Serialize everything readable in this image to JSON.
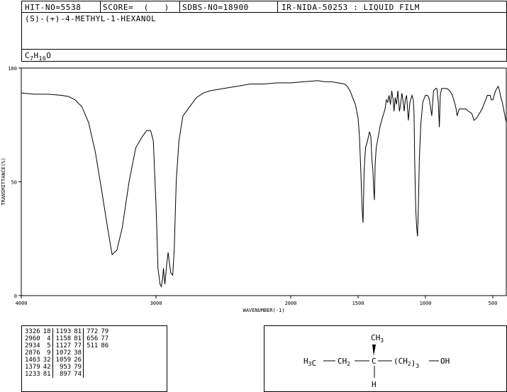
{
  "header": {
    "hit_no": "HIT-NO=5538",
    "score": "SCORE=  (   )",
    "sdbs_no": "SDBS-NO=18900",
    "ir_code": "IR-NIDA-50253 : LIQUID FILM"
  },
  "compound": {
    "name": "(S)-(+)-4-METHYL-1-HEXANOL",
    "formula_parts": [
      "C",
      "7",
      "H",
      "16",
      "O"
    ]
  },
  "structure": {
    "ch3_top": "CH3",
    "chain_left": "H3C",
    "ch2": "CH2",
    "center_c": "C",
    "group": "(CH2)3",
    "oh": "OH",
    "h_bottom": "H"
  },
  "peak_table": {
    "columns": [
      [
        [
          "3326",
          "18"
        ],
        [
          "2960",
          "4"
        ],
        [
          "2934",
          "5"
        ],
        [
          "2876",
          "9"
        ],
        [
          "1463",
          "32"
        ],
        [
          "1379",
          "42"
        ],
        [
          "1233",
          "81"
        ]
      ],
      [
        [
          "1193",
          "81"
        ],
        [
          "1158",
          "81"
        ],
        [
          "1127",
          "77"
        ],
        [
          "1072",
          "38"
        ],
        [
          "1059",
          "26"
        ],
        [
          "953",
          "79"
        ],
        [
          "897",
          "74"
        ]
      ],
      [
        [
          "772",
          "79"
        ],
        [
          "656",
          "77"
        ],
        [
          "511",
          "86"
        ]
      ]
    ]
  },
  "chart_data": {
    "type": "line",
    "title": "",
    "xlabel": "WAVENUMBER(-1)",
    "ylabel": "TRANSMITTANCE(%)",
    "xlim": [
      4000,
      400
    ],
    "ylim": [
      0,
      100
    ],
    "xticks": [
      4000,
      3000,
      2000,
      1500,
      1000,
      500
    ],
    "xtick_labels": [
      "4000",
      "3000",
      "2000",
      "1500",
      "1000",
      "500"
    ],
    "yticks": [
      0,
      50,
      100
    ],
    "ytick_labels": [
      "0",
      "50",
      "100"
    ],
    "grid": false,
    "series": [
      {
        "name": "",
        "x": [
          4000,
          3900,
          3800,
          3700,
          3650,
          3600,
          3550,
          3500,
          3450,
          3400,
          3360,
          3326,
          3290,
          3250,
          3200,
          3150,
          3100,
          3070,
          3040,
          3020,
          3000,
          2985,
          2970,
          2960,
          2950,
          2945,
          2934,
          2920,
          2910,
          2900,
          2890,
          2876,
          2865,
          2850,
          2830,
          2800,
          2750,
          2700,
          2650,
          2600,
          2500,
          2400,
          2300,
          2200,
          2100,
          2000,
          1900,
          1800,
          1750,
          1700,
          1650,
          1600,
          1580,
          1560,
          1540,
          1520,
          1500,
          1490,
          1480,
          1470,
          1463,
          1455,
          1445,
          1430,
          1415,
          1405,
          1398,
          1390,
          1385,
          1379,
          1373,
          1365,
          1350,
          1335,
          1320,
          1300,
          1290,
          1280,
          1270,
          1260,
          1250,
          1240,
          1233,
          1225,
          1215,
          1205,
          1193,
          1185,
          1175,
          1165,
          1158,
          1150,
          1140,
          1127,
          1115,
          1100,
          1090,
          1085,
          1080,
          1072,
          1065,
          1059,
          1052,
          1045,
          1035,
          1020,
          1000,
          985,
          975,
          965,
          953,
          940,
          925,
          915,
          905,
          897,
          890,
          880,
          860,
          840,
          820,
          800,
          790,
          780,
          772,
          765,
          750,
          720,
          700,
          680,
          656,
          640,
          620,
          600,
          580,
          560,
          540,
          520,
          511,
          500,
          490,
          480,
          470,
          460,
          450,
          440,
          430,
          420,
          410,
          400
        ],
        "y": [
          89,
          88.5,
          88.5,
          88,
          87.5,
          86,
          83,
          76,
          63,
          45,
          30,
          18,
          20,
          30,
          50,
          65,
          70,
          72.5,
          72.5,
          68,
          40,
          12,
          5,
          4,
          8,
          12,
          5,
          14,
          19,
          14,
          10,
          9,
          20,
          50,
          68,
          79,
          83,
          87,
          89,
          90,
          91,
          92,
          93,
          93,
          93.5,
          93.5,
          94,
          94.5,
          94,
          94,
          93.5,
          93,
          92,
          90,
          87,
          84,
          78,
          70,
          55,
          38,
          32,
          55,
          65,
          68,
          72,
          70,
          60,
          55,
          48,
          42,
          58,
          65,
          70,
          75,
          78,
          82,
          86,
          85,
          88,
          84,
          90,
          86,
          81,
          87,
          84,
          90,
          81,
          84,
          89,
          85,
          81,
          86,
          88,
          77,
          85,
          88,
          86,
          80,
          60,
          38,
          30,
          26,
          40,
          60,
          75,
          85,
          88,
          88,
          87,
          84,
          79,
          90,
          91,
          91,
          85,
          74,
          88,
          91,
          91,
          91,
          90,
          88,
          86,
          84,
          82,
          79,
          82,
          82,
          82,
          81,
          80,
          77,
          78,
          80,
          82,
          85,
          88,
          88,
          86,
          86,
          88,
          90,
          91,
          92,
          90,
          87,
          85,
          82,
          79,
          76
        ]
      }
    ]
  }
}
